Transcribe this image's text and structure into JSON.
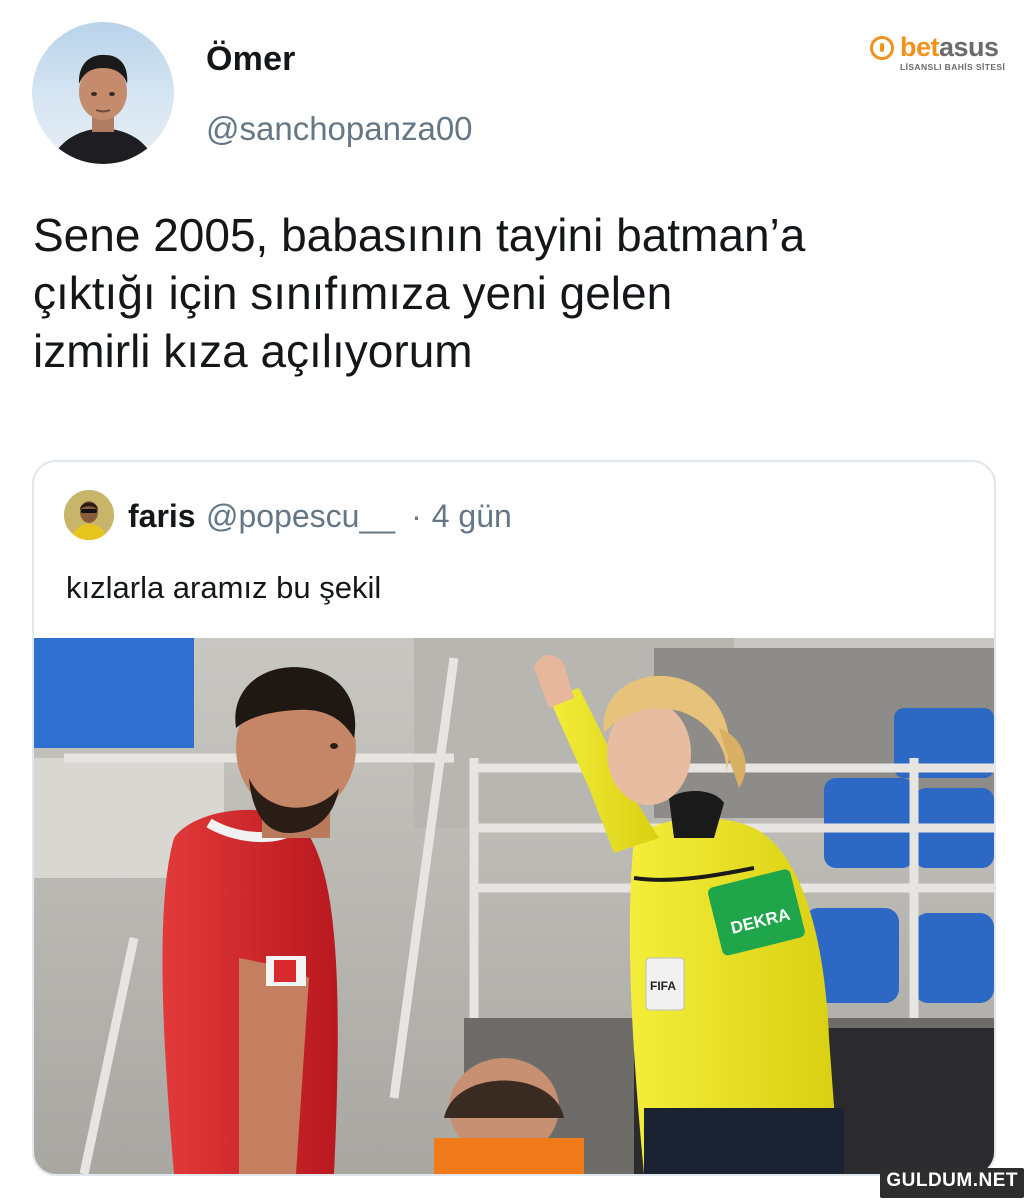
{
  "brand": {
    "name_a": "bet",
    "name_b": "asus",
    "tagline": "LİSANSLI BAHİS SİTESİ"
  },
  "tweet": {
    "display_name": "Ömer",
    "handle": "@sanchopanza00",
    "text_lines": [
      "Sene 2005, babasının tayini batman’a",
      "çıktığı için sınıfımıza yeni gelen",
      "izmirli kıza açılıyorum"
    ]
  },
  "quoted_tweet": {
    "display_name": "faris",
    "handle": "@popescu__",
    "separator": "·",
    "time": "4 gün",
    "text": "kızlarla aramız bu şekil",
    "photo": {
      "sponsor_text": "DEKRA",
      "badge_text": "FIFA"
    }
  },
  "watermark": "GULDUM.NET",
  "colors": {
    "text_primary": "#14171a",
    "text_secondary": "#657786",
    "card_border": "#e1e8ed",
    "brand_orange": "#f2921c",
    "player_red": "#d8292f",
    "referee_yellow": "#f3ea2a",
    "seat_blue": "#2c68c4"
  }
}
